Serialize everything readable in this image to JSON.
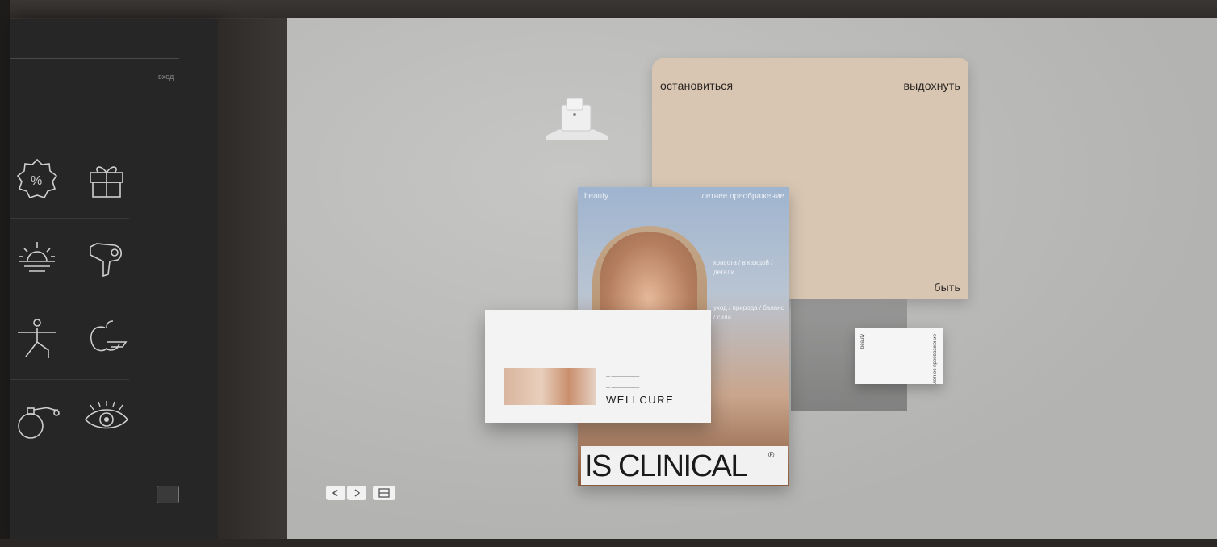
{
  "sidebar": {
    "small_label": "вход",
    "icons": [
      "percent-badge-icon",
      "gift-icon",
      "sunrise-icon",
      "hair-dryer-icon",
      "yoga-pose-icon",
      "apple-hand-icon",
      "perfume-bottle-icon",
      "eye-icon"
    ]
  },
  "mockup": {
    "folder": {
      "left": "остановиться",
      "right": "выдохнуть",
      "bottom": "быть"
    },
    "poster": {
      "top_left": "beauty",
      "top_right": "летнее преображение",
      "side_text_1": "красота / в каждой / детали",
      "side_text_2": "уход / природа / баланс / сила",
      "brand": "IS CLINICAL",
      "brand_mark": "®"
    },
    "envelope": {
      "logo": "WELLCURE",
      "address_lines": [
        "— ———————",
        "— ———————",
        "— ———————"
      ]
    },
    "card": {
      "left_text": "beauty",
      "right_text": "летнее преображение"
    }
  }
}
